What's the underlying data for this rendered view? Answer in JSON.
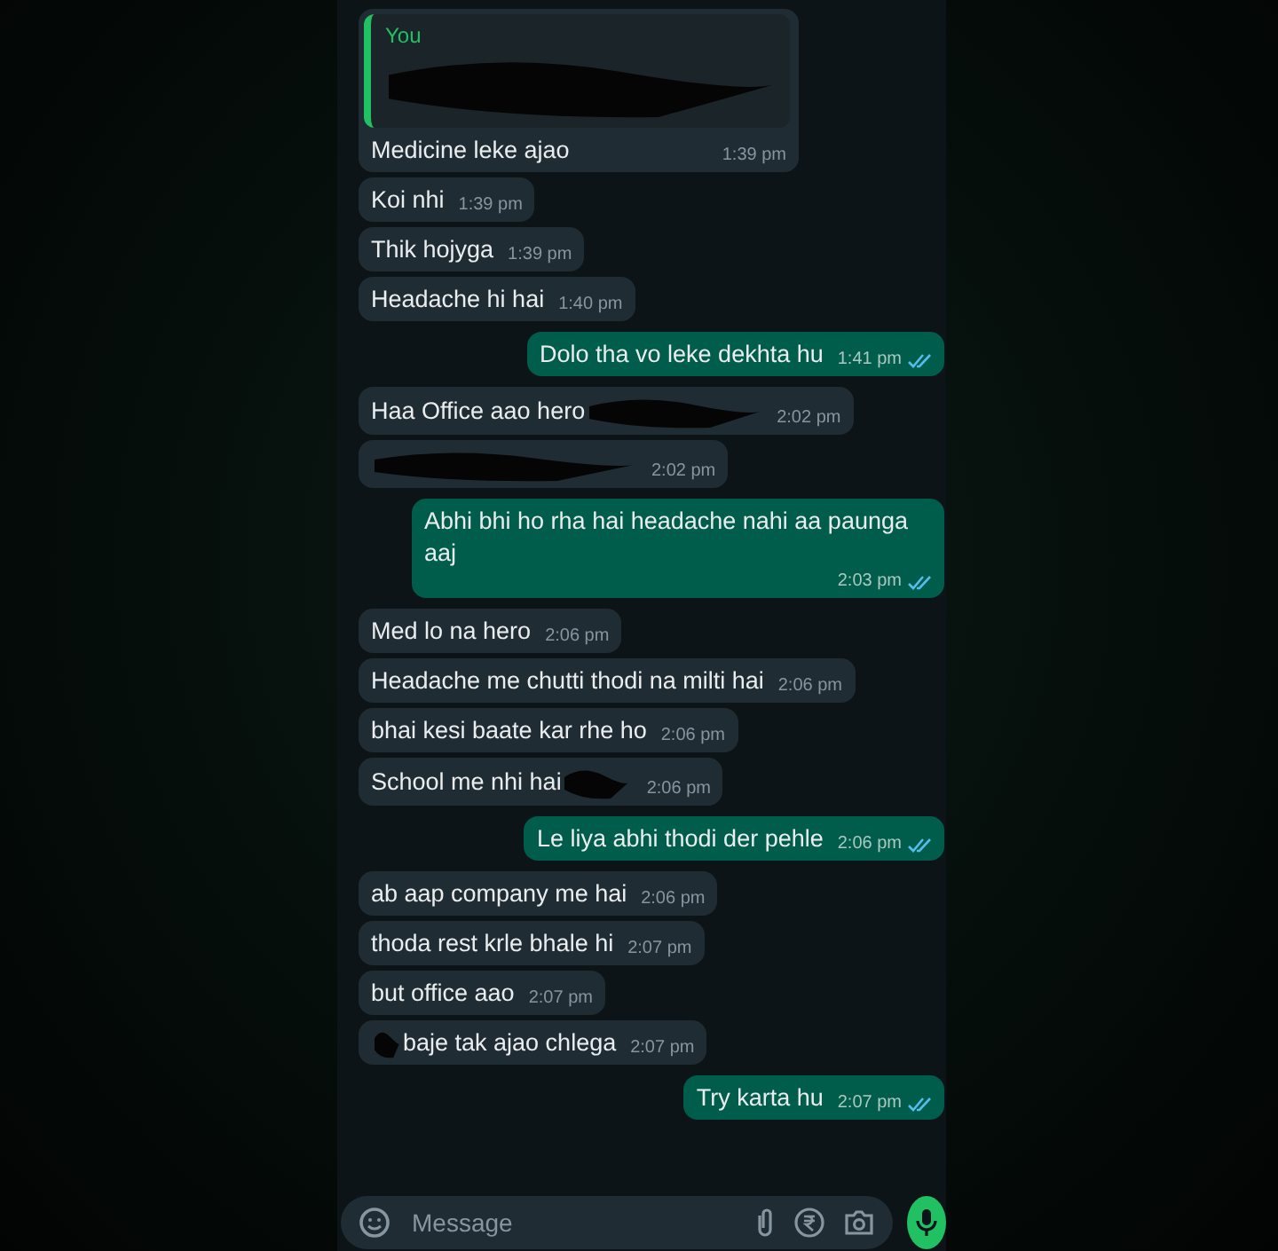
{
  "messages": [
    {
      "outgoing": false,
      "kind": "plain",
      "quote": {
        "author": "You",
        "masked": true
      },
      "text": "Medicine leke ajao",
      "time": "1:39 pm"
    },
    {
      "outgoing": false,
      "kind": "plain",
      "text": "Koi nhi",
      "time": "1:39 pm"
    },
    {
      "outgoing": false,
      "kind": "plain",
      "text": "Thik hojyga",
      "time": "1:39 pm"
    },
    {
      "outgoing": false,
      "kind": "plain",
      "text": "Headache hi hai",
      "time": "1:40 pm"
    },
    {
      "outgoing": true,
      "kind": "plain",
      "text": "Dolo tha vo leke dekhta hu",
      "time": "1:41 pm",
      "read": true
    },
    {
      "outgoing": false,
      "kind": "tailmasked",
      "text": "Haa Office aao hero",
      "time": "2:02 pm"
    },
    {
      "outgoing": false,
      "kind": "masked",
      "time": "2:02 pm"
    },
    {
      "outgoing": true,
      "kind": "plain",
      "text": "Abhi bhi ho rha hai headache nahi aa paunga aaj",
      "time": "2:03 pm",
      "read": true
    },
    {
      "outgoing": false,
      "kind": "plain",
      "text": "Med lo na hero",
      "time": "2:06 pm"
    },
    {
      "outgoing": false,
      "kind": "plain",
      "text": "Headache me chutti thodi na milti hai",
      "time": "2:06 pm"
    },
    {
      "outgoing": false,
      "kind": "plain",
      "text": "bhai kesi baate kar rhe ho",
      "time": "2:06 pm"
    },
    {
      "outgoing": false,
      "kind": "tailmasked",
      "text": "School me nhi hai",
      "time": "2:06 pm"
    },
    {
      "outgoing": true,
      "kind": "plain",
      "text": "Le liya abhi thodi der pehle",
      "time": "2:06 pm",
      "read": true
    },
    {
      "outgoing": false,
      "kind": "plain",
      "text": "ab aap company me hai",
      "time": "2:06 pm"
    },
    {
      "outgoing": false,
      "kind": "plain",
      "text": "thoda rest krle bhale hi",
      "time": "2:07 pm"
    },
    {
      "outgoing": false,
      "kind": "plain",
      "text": "but office aao",
      "time": "2:07 pm"
    },
    {
      "outgoing": false,
      "kind": "headmasked",
      "text": "baje tak ajao chlega",
      "time": "2:07 pm"
    },
    {
      "outgoing": true,
      "kind": "plain",
      "text": "Try karta hu",
      "time": "2:07 pm",
      "read": true
    }
  ],
  "composer": {
    "placeholder": "Message"
  }
}
